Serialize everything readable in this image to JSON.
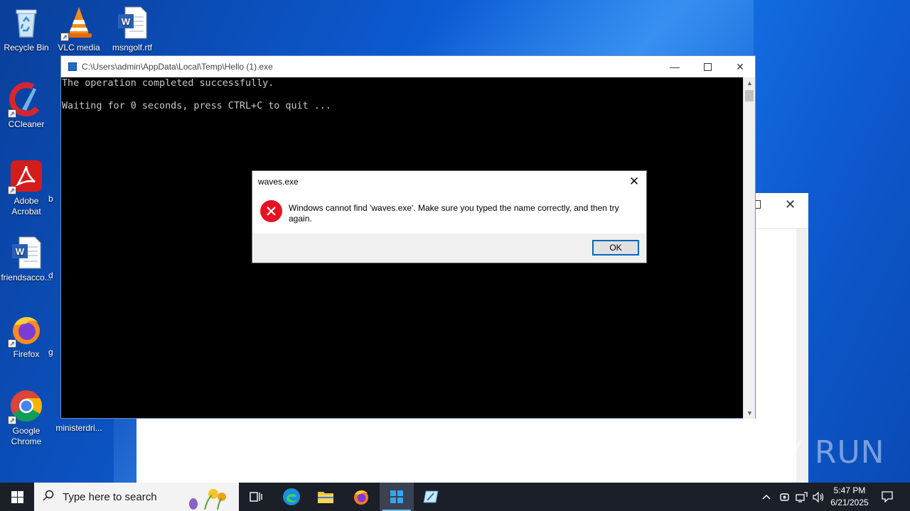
{
  "desktop": {
    "icons": [
      {
        "label": "Recycle Bin"
      },
      {
        "label": "VLC media"
      },
      {
        "label": "msngolf.rtf"
      },
      {
        "label": "CCleaner"
      },
      {
        "label": "Adobe Acrobat"
      },
      {
        "label": "friendsacco..."
      },
      {
        "label": "Firefox"
      },
      {
        "label": "Google Chrome"
      },
      {
        "label": "ministerdri..."
      }
    ],
    "partial_labels": [
      "b",
      "d",
      "g"
    ]
  },
  "console": {
    "title": "C:\\Users\\admin\\AppData\\Local\\Temp\\Hello (1).exe",
    "lines": [
      "The operation completed successfully.",
      "",
      "Waiting for 0 seconds, press CTRL+C to quit ..."
    ]
  },
  "dialog": {
    "title": "waves.exe",
    "message": "Windows cannot find 'waves.exe'. Make sure you typed the name correctly, and then try again.",
    "ok_label": "OK"
  },
  "taskbar": {
    "search_placeholder": "Type here to search",
    "time": "5:47 PM",
    "date": "6/21/2025"
  },
  "watermark": "ANY RUN",
  "colors": {
    "accent": "#0067c0",
    "error": "#e81123",
    "taskbar": "#1a1f28"
  }
}
